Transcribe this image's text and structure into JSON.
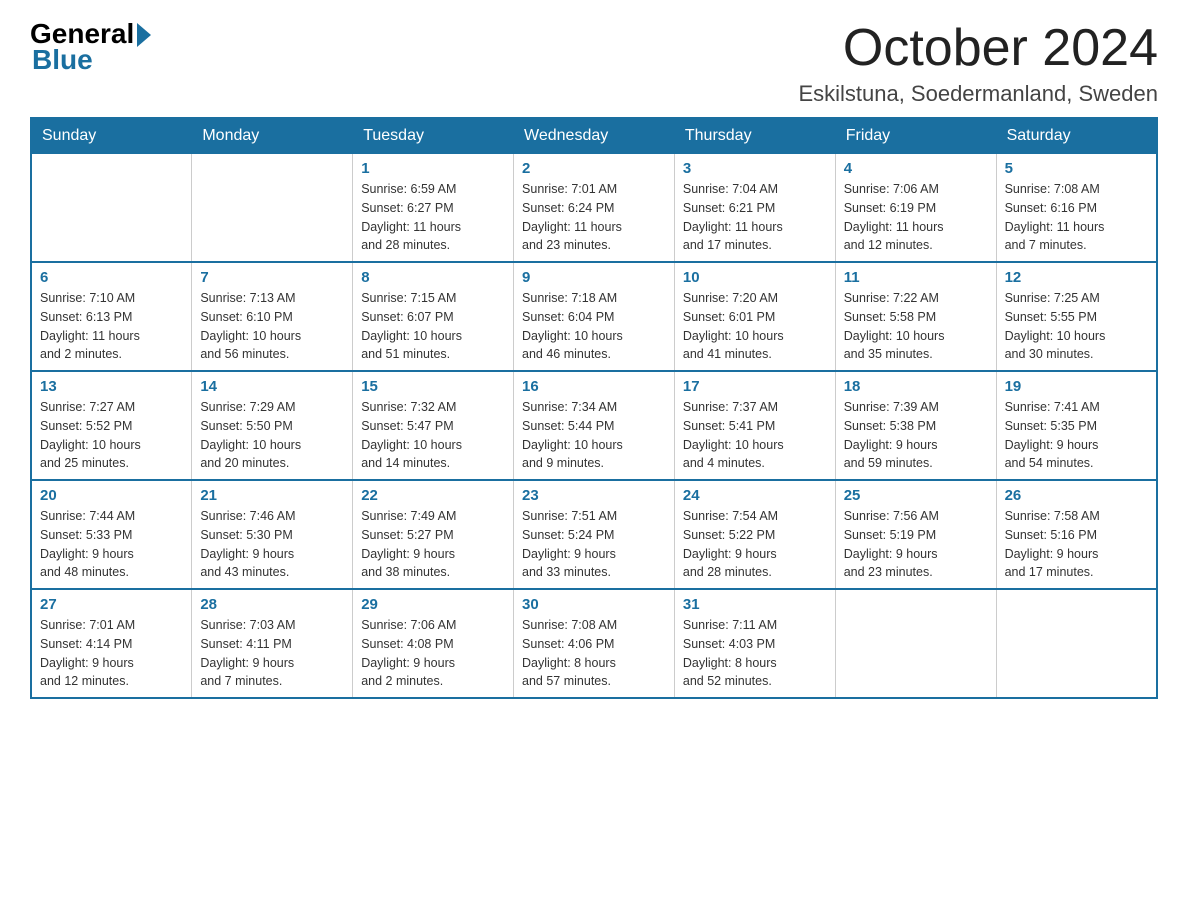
{
  "logo": {
    "general": "General",
    "blue": "Blue"
  },
  "title": "October 2024",
  "location": "Eskilstuna, Soedermanland, Sweden",
  "days_of_week": [
    "Sunday",
    "Monday",
    "Tuesday",
    "Wednesday",
    "Thursday",
    "Friday",
    "Saturday"
  ],
  "weeks": [
    [
      {
        "day": "",
        "info": ""
      },
      {
        "day": "",
        "info": ""
      },
      {
        "day": "1",
        "info": "Sunrise: 6:59 AM\nSunset: 6:27 PM\nDaylight: 11 hours\nand 28 minutes."
      },
      {
        "day": "2",
        "info": "Sunrise: 7:01 AM\nSunset: 6:24 PM\nDaylight: 11 hours\nand 23 minutes."
      },
      {
        "day": "3",
        "info": "Sunrise: 7:04 AM\nSunset: 6:21 PM\nDaylight: 11 hours\nand 17 minutes."
      },
      {
        "day": "4",
        "info": "Sunrise: 7:06 AM\nSunset: 6:19 PM\nDaylight: 11 hours\nand 12 minutes."
      },
      {
        "day": "5",
        "info": "Sunrise: 7:08 AM\nSunset: 6:16 PM\nDaylight: 11 hours\nand 7 minutes."
      }
    ],
    [
      {
        "day": "6",
        "info": "Sunrise: 7:10 AM\nSunset: 6:13 PM\nDaylight: 11 hours\nand 2 minutes."
      },
      {
        "day": "7",
        "info": "Sunrise: 7:13 AM\nSunset: 6:10 PM\nDaylight: 10 hours\nand 56 minutes."
      },
      {
        "day": "8",
        "info": "Sunrise: 7:15 AM\nSunset: 6:07 PM\nDaylight: 10 hours\nand 51 minutes."
      },
      {
        "day": "9",
        "info": "Sunrise: 7:18 AM\nSunset: 6:04 PM\nDaylight: 10 hours\nand 46 minutes."
      },
      {
        "day": "10",
        "info": "Sunrise: 7:20 AM\nSunset: 6:01 PM\nDaylight: 10 hours\nand 41 minutes."
      },
      {
        "day": "11",
        "info": "Sunrise: 7:22 AM\nSunset: 5:58 PM\nDaylight: 10 hours\nand 35 minutes."
      },
      {
        "day": "12",
        "info": "Sunrise: 7:25 AM\nSunset: 5:55 PM\nDaylight: 10 hours\nand 30 minutes."
      }
    ],
    [
      {
        "day": "13",
        "info": "Sunrise: 7:27 AM\nSunset: 5:52 PM\nDaylight: 10 hours\nand 25 minutes."
      },
      {
        "day": "14",
        "info": "Sunrise: 7:29 AM\nSunset: 5:50 PM\nDaylight: 10 hours\nand 20 minutes."
      },
      {
        "day": "15",
        "info": "Sunrise: 7:32 AM\nSunset: 5:47 PM\nDaylight: 10 hours\nand 14 minutes."
      },
      {
        "day": "16",
        "info": "Sunrise: 7:34 AM\nSunset: 5:44 PM\nDaylight: 10 hours\nand 9 minutes."
      },
      {
        "day": "17",
        "info": "Sunrise: 7:37 AM\nSunset: 5:41 PM\nDaylight: 10 hours\nand 4 minutes."
      },
      {
        "day": "18",
        "info": "Sunrise: 7:39 AM\nSunset: 5:38 PM\nDaylight: 9 hours\nand 59 minutes."
      },
      {
        "day": "19",
        "info": "Sunrise: 7:41 AM\nSunset: 5:35 PM\nDaylight: 9 hours\nand 54 minutes."
      }
    ],
    [
      {
        "day": "20",
        "info": "Sunrise: 7:44 AM\nSunset: 5:33 PM\nDaylight: 9 hours\nand 48 minutes."
      },
      {
        "day": "21",
        "info": "Sunrise: 7:46 AM\nSunset: 5:30 PM\nDaylight: 9 hours\nand 43 minutes."
      },
      {
        "day": "22",
        "info": "Sunrise: 7:49 AM\nSunset: 5:27 PM\nDaylight: 9 hours\nand 38 minutes."
      },
      {
        "day": "23",
        "info": "Sunrise: 7:51 AM\nSunset: 5:24 PM\nDaylight: 9 hours\nand 33 minutes."
      },
      {
        "day": "24",
        "info": "Sunrise: 7:54 AM\nSunset: 5:22 PM\nDaylight: 9 hours\nand 28 minutes."
      },
      {
        "day": "25",
        "info": "Sunrise: 7:56 AM\nSunset: 5:19 PM\nDaylight: 9 hours\nand 23 minutes."
      },
      {
        "day": "26",
        "info": "Sunrise: 7:58 AM\nSunset: 5:16 PM\nDaylight: 9 hours\nand 17 minutes."
      }
    ],
    [
      {
        "day": "27",
        "info": "Sunrise: 7:01 AM\nSunset: 4:14 PM\nDaylight: 9 hours\nand 12 minutes."
      },
      {
        "day": "28",
        "info": "Sunrise: 7:03 AM\nSunset: 4:11 PM\nDaylight: 9 hours\nand 7 minutes."
      },
      {
        "day": "29",
        "info": "Sunrise: 7:06 AM\nSunset: 4:08 PM\nDaylight: 9 hours\nand 2 minutes."
      },
      {
        "day": "30",
        "info": "Sunrise: 7:08 AM\nSunset: 4:06 PM\nDaylight: 8 hours\nand 57 minutes."
      },
      {
        "day": "31",
        "info": "Sunrise: 7:11 AM\nSunset: 4:03 PM\nDaylight: 8 hours\nand 52 minutes."
      },
      {
        "day": "",
        "info": ""
      },
      {
        "day": "",
        "info": ""
      }
    ]
  ]
}
